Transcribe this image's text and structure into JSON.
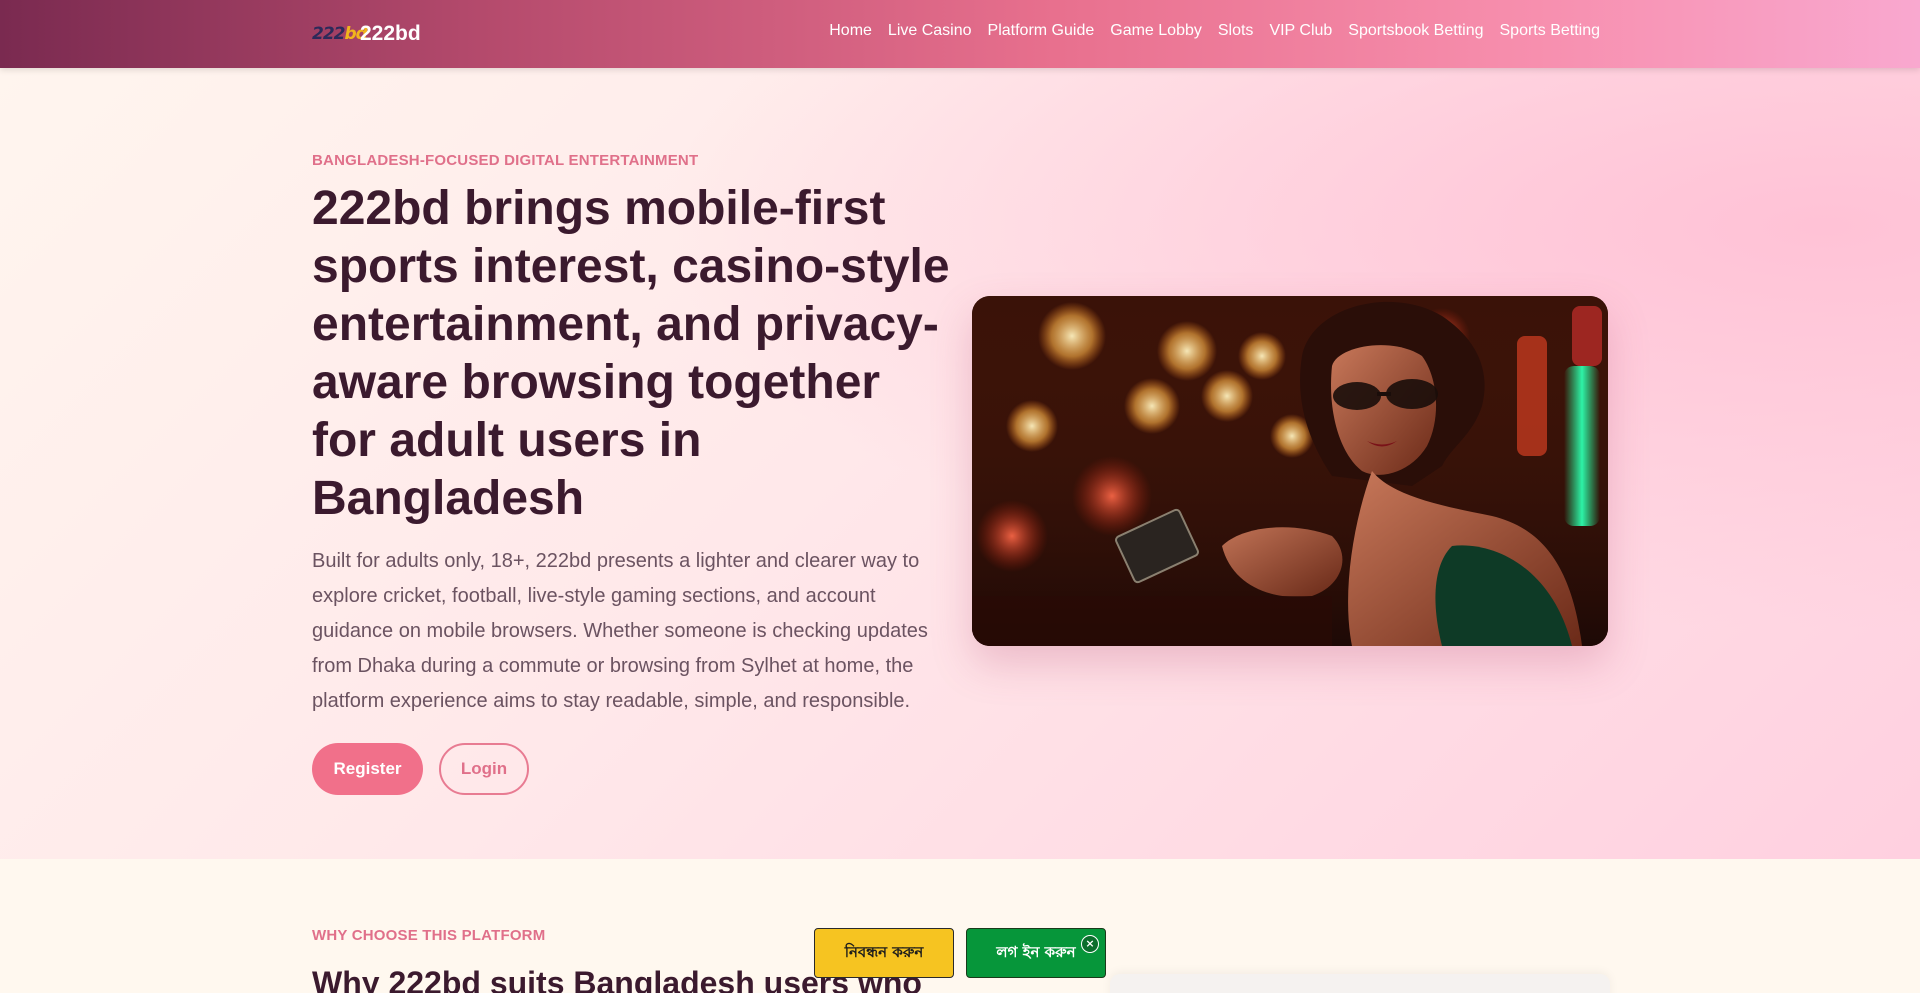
{
  "header": {
    "brand_name": "222bd",
    "logo_text_a": "222",
    "logo_text_b": "bd",
    "nav": [
      "Home",
      "Live Casino",
      "Platform Guide",
      "Game Lobby",
      "Slots",
      "VIP Club",
      "Sportsbook Betting",
      "Sports Betting"
    ]
  },
  "hero": {
    "eyebrow": "BANGLADESH-FOCUSED DIGITAL ENTERTAINMENT",
    "title": "222bd brings mobile-first sports interest, casino-style entertainment, and privacy-aware browsing together for adult users in Bangladesh",
    "text": "Built for adults only, 18+, 222bd presents a lighter and clearer way to explore cricket, football, live-style gaming sections, and account guidance on mobile browsers. Whether someone is checking updates from Dhaka during a commute or browsing from Sylhet at home, the platform experience aims to stay readable, simple, and responsible.",
    "register_label": "Register",
    "login_label": "Login"
  },
  "section2": {
    "eyebrow": "WHY CHOOSE THIS PLATFORM",
    "title": "Why 222bd suits Bangladesh users who"
  },
  "floating_bar": {
    "register_label": "নিবন্ধন করুন",
    "login_label": "লগ ইন করুন",
    "close_symbol": "×"
  },
  "colors": {
    "accent": "#f1708a",
    "heading": "#3b1a2e",
    "float_register": "#f6c421",
    "float_login": "#06963a"
  }
}
